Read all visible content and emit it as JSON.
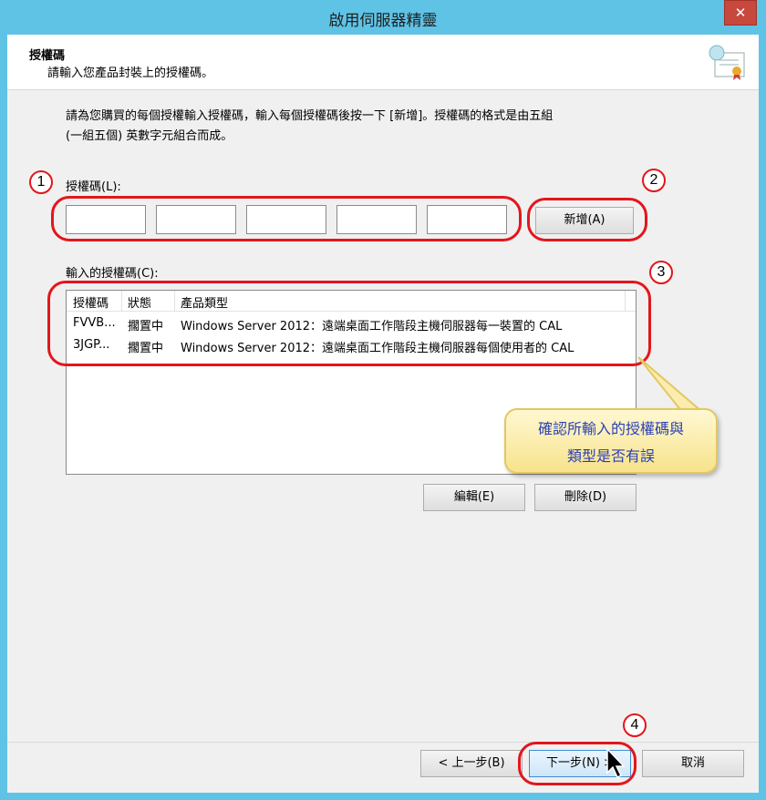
{
  "window": {
    "title": "啟用伺服器精靈",
    "close_symbol": "✕"
  },
  "header": {
    "title": "授權碼",
    "subtitle": "請輸入您產品封裝上的授權碼。"
  },
  "intro": {
    "line1": "請為您購買的每個授權輸入授權碼，輸入每個授權碼後按一下 [新增]。授權碼的格式是由五組",
    "line2": "(一組五個) 英數字元組合而成。"
  },
  "license_key": {
    "label": "授權碼(L):",
    "segments": [
      "",
      "",
      "",
      "",
      ""
    ],
    "add_button": "新增(A)"
  },
  "entered_keys": {
    "label": "輸入的授權碼(C):",
    "columns": [
      "授權碼",
      "狀態",
      "產品類型"
    ],
    "rows": [
      [
        "FVVB...",
        "擱置中",
        "Windows Server 2012：遠端桌面工作階段主機伺服器每一裝置的 CAL"
      ],
      [
        "3JGP...",
        "擱置中",
        "Windows Server 2012：遠端桌面工作階段主機伺服器每個使用者的 CAL"
      ]
    ],
    "edit_button": "編輯(E)",
    "delete_button": "刪除(D)"
  },
  "callout": {
    "line1": "確認所輸入的授權碼與",
    "line2": "類型是否有誤"
  },
  "annotations": [
    "1",
    "2",
    "3",
    "4"
  ],
  "footer": {
    "back_button": "< 上一步(B)",
    "next_button": "下一步(N) >",
    "cancel_button": "取消"
  },
  "colors": {
    "titlebar": "#5fc3e6",
    "annotation_red": "#e3161c",
    "callout_text": "#2a3fb8",
    "close_red": "#c7483c"
  }
}
